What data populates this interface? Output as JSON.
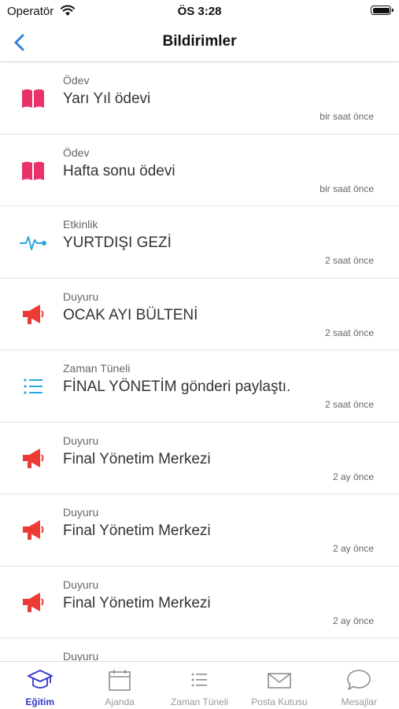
{
  "status_bar": {
    "carrier": "Operatör",
    "time": "ÖS 3:28"
  },
  "nav": {
    "title": "Bildirimler"
  },
  "colors": {
    "accent": "#2f7fe0",
    "homework": "#e8336a",
    "event": "#29a8df",
    "announcement": "#ee3a36",
    "timeline": "#29a8df",
    "tab_active": "#3535c8"
  },
  "notifications": [
    {
      "icon": "book-icon",
      "category": "Ödev",
      "text": "Yarı Yıl ödevi",
      "time": "bir saat önce"
    },
    {
      "icon": "book-icon",
      "category": "Ödev",
      "text": "Hafta sonu ödevi",
      "time": "bir saat önce"
    },
    {
      "icon": "activity-icon",
      "category": "Etkinlik",
      "text": "YURTDIŞI GEZİ",
      "time": "2 saat önce"
    },
    {
      "icon": "megaphone-icon",
      "category": "Duyuru",
      "text": "OCAK AYI BÜLTENİ",
      "time": "2 saat önce"
    },
    {
      "icon": "list-icon",
      "category": "Zaman Tüneli",
      "text": "FİNAL YÖNETİM gönderi paylaştı.",
      "time": "2 saat önce"
    },
    {
      "icon": "megaphone-icon",
      "category": "Duyuru",
      "text": "Final Yönetim Merkezi",
      "time": "2 ay önce"
    },
    {
      "icon": "megaphone-icon",
      "category": "Duyuru",
      "text": "Final Yönetim Merkezi",
      "time": "2 ay önce"
    },
    {
      "icon": "megaphone-icon",
      "category": "Duyuru",
      "text": "Final Yönetim Merkezi",
      "time": "2 ay önce"
    },
    {
      "icon": "megaphone-icon",
      "category": "Duyuru",
      "text": "",
      "time": ""
    }
  ],
  "tabs": [
    {
      "icon": "graduation-cap-icon",
      "label": "Eğitim",
      "active": true
    },
    {
      "icon": "calendar-icon",
      "label": "Ajanda",
      "active": false
    },
    {
      "icon": "list-icon",
      "label": "Zaman Tüneli",
      "active": false
    },
    {
      "icon": "mail-icon",
      "label": "Posta Kutusu",
      "active": false
    },
    {
      "icon": "chat-icon",
      "label": "Mesajlar",
      "active": false
    }
  ]
}
